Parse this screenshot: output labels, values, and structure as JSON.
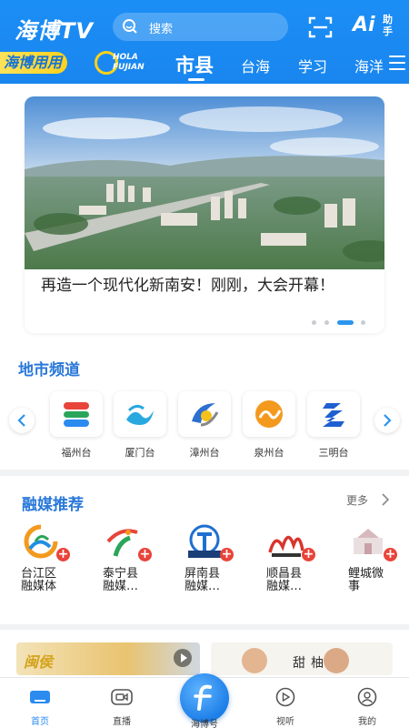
{
  "header": {
    "logo": "海博TV",
    "search_placeholder": "搜索",
    "assistant_label_ai": "Ai",
    "assistant_label": "助手"
  },
  "tabs": {
    "special": "海博用用",
    "hola_line1": "HOLA",
    "hola_line2": "FUJIAN",
    "items": [
      "市县",
      "台海",
      "学习",
      "海洋"
    ],
    "active": "市县"
  },
  "banner": {
    "title": "再造一个现代化新南安！刚刚，大会开幕！",
    "dots_count": 4,
    "active_dot": 2
  },
  "city_channels": {
    "title": "地市频道",
    "items": [
      {
        "label": "福州台",
        "icon": "fuzhou-tv-logo"
      },
      {
        "label": "厦门台",
        "icon": "xiamen-tv-logo"
      },
      {
        "label": "漳州台",
        "icon": "zhangzhou-tv-logo"
      },
      {
        "label": "泉州台",
        "icon": "quanzhou-tv-logo"
      },
      {
        "label": "三明台",
        "icon": "sanming-tv-logo"
      }
    ]
  },
  "media": {
    "title": "融媒推荐",
    "more_label": "更多",
    "items": [
      {
        "name_line1": "台江区",
        "name_line2": "融媒体"
      },
      {
        "name_line1": "泰宁县",
        "name_line2": "融媒…"
      },
      {
        "name_line1": "屏南县",
        "name_line2": "融媒…"
      },
      {
        "name_line1": "顺昌县",
        "name_line2": "融媒…"
      },
      {
        "name_line1": "鲤城微",
        "name_line2": "事"
      }
    ]
  },
  "thumbnails": {
    "left_text": "闽侯",
    "right_text": "甜柚"
  },
  "bottom_nav": {
    "items": [
      {
        "label": "首页",
        "active": true
      },
      {
        "label": "直播",
        "active": false
      },
      {
        "label": "海博号",
        "active": false
      },
      {
        "label": "视听",
        "active": false
      },
      {
        "label": "我的",
        "active": false
      }
    ]
  },
  "colors": {
    "brand_blue": "#1a86ef",
    "accent_yellow": "#ffd21c",
    "section_title": "#2a78d9",
    "badge_red": "#e8443a"
  }
}
